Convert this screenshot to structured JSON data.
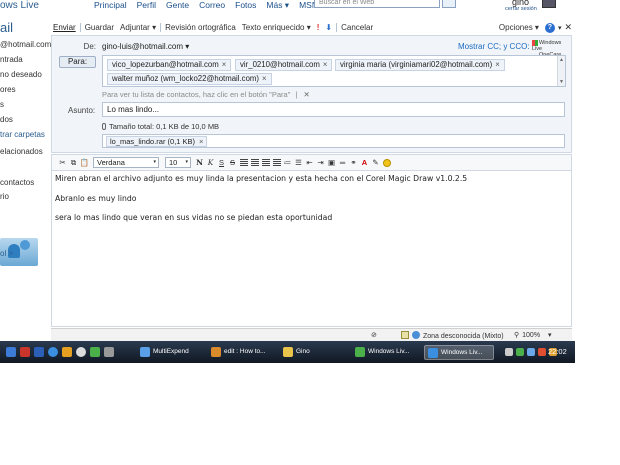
{
  "top": {
    "brand": "ows Live",
    "nav": [
      "Principal",
      "Perfil",
      "Gente",
      "Correo",
      "Fotos",
      "Más ▾",
      "MSN ▾"
    ],
    "search_placeholder": "Buscar en el Web",
    "user_name": "gino",
    "sign_out": "cerrar sesión"
  },
  "sidebar": {
    "title": "ail",
    "items": [
      "@hotmail.com",
      "ntrada",
      "no deseado",
      "ores",
      "s",
      "dos",
      "trar carpetas",
      "elacionados",
      "contactos",
      "rio",
      "ol >"
    ]
  },
  "toolbar": {
    "send": "Enviar",
    "save": "Guardar",
    "attach": "Adjuntar ▾",
    "spell": "Revisión ortográfica",
    "rich_text": "Texto enriquecido ▾",
    "priority_high": "!",
    "priority_low": "⬇",
    "cancel": "Cancelar",
    "options": "Opciones ▾",
    "help": "?",
    "help_caret": "▾",
    "close": "✕"
  },
  "header": {
    "from_label": "De:",
    "from_value": "gino-luis@hotmail.com ▾",
    "show_cc": "Mostrar CC; y CCO:",
    "logo_text_1": "Windows Live",
    "logo_text_2": "OneCare",
    "to_label": "Para:",
    "recipients": [
      "vico_lopezurban@hotmail.com",
      "vir_0210@hotmail.com",
      "virginia maria (virginiamari02@hotmail.com)",
      "walter muñoz (wm_locko22@hotmail.com)"
    ],
    "remove_symbol": "×",
    "contacts_hint": "Para ver tu lista de contactos, haz clic en el botón \"Para\"",
    "hint_divider": "|",
    "hint_close": "✕",
    "subject_label": "Asunto:",
    "subject_value": "Lo mas lindo...",
    "attach_total": "Tamaño total: 0,1 KB de 10,0 MB",
    "attachment": "lo_mas_lindo.rar (0,1 KB)"
  },
  "format": {
    "font": "Verdana",
    "size": "10",
    "bold": "N",
    "italic": "K",
    "underline": "S",
    "strike": "S",
    "font_color": "A",
    "caret": "▾"
  },
  "body": {
    "lines": [
      "Miren abran el archivo adjunto es muy linda la presentacion y esta hecha con el Corel Magic Draw v1.0.2.5",
      "Abranlo es muy lindo",
      "sera lo mas lindo que veran en sus vidas no se piedan esta oportunidad"
    ]
  },
  "status": {
    "zone": "Zona desconocida (Mixto)",
    "zoom": "100%",
    "zoom_caret": "▾"
  },
  "taskbar": {
    "tasks": [
      "MultiExpend",
      "edit : How to...",
      "Gino",
      "Windows Liv...",
      "Windows Liv..."
    ],
    "clock": "22:02"
  }
}
